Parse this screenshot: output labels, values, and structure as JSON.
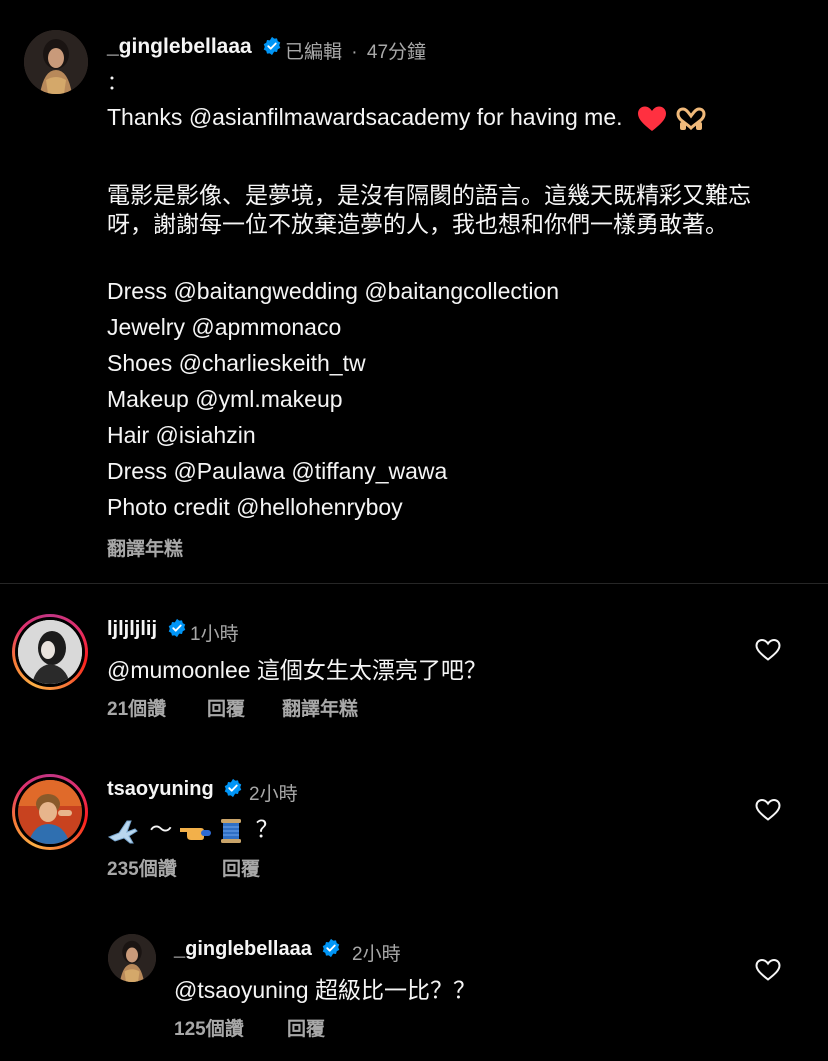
{
  "post": {
    "username": "_ginglebellaaa",
    "edited": "已編輯",
    "separator": "·",
    "time": "47分鐘",
    "colon": "：",
    "thanks_line": "Thanks @asianfilmawardsacademy for having me.",
    "zh_line1": "電影是影像、是夢境，是沒有隔閡的語言。這幾天既精彩又難忘",
    "zh_line2": "呀，謝謝每一位不放棄造夢的人，我也想和你們一樣勇敢著。",
    "credits": [
      "Dress @baitangwedding @baitangcollection",
      "Jewelry @apmmonaco",
      "Shoes @charlieskeith_tw",
      "Makeup @yml.makeup",
      "Hair @isiahzin",
      "Dress @Paulawa @tiffany_wawa",
      "Photo credit @hellohenryboy"
    ],
    "translate": "翻譯年糕"
  },
  "comments": [
    {
      "username": "ljljljlij",
      "time": "1小時",
      "text": "@mumoonlee 這個女生太漂亮了吧？",
      "likes": "21個讚",
      "reply": "回覆",
      "translate": "翻譯年糕"
    },
    {
      "username": "tsaoyuning",
      "time": "2小時",
      "text_tilde": "～",
      "text_q": "？",
      "likes": "235個讚",
      "reply": "回覆"
    },
    {
      "username": "_ginglebellaaa",
      "time": "2小時",
      "text": "@tsaoyuning 超級比一比？？",
      "likes": "125個讚",
      "reply": "回覆"
    }
  ],
  "icons": {
    "verified": "verified-badge-icon",
    "heart": "heart-outline-icon",
    "airplane": "airplane-emoji",
    "hand": "pointing-hand-emoji",
    "thread": "thread-spool-emoji"
  },
  "colors": {
    "background": "#000000",
    "text": "#f5f5f5",
    "secondary": "#a8a8a8",
    "verified": "#0095f6",
    "heart_emoji": "#ff3040"
  }
}
